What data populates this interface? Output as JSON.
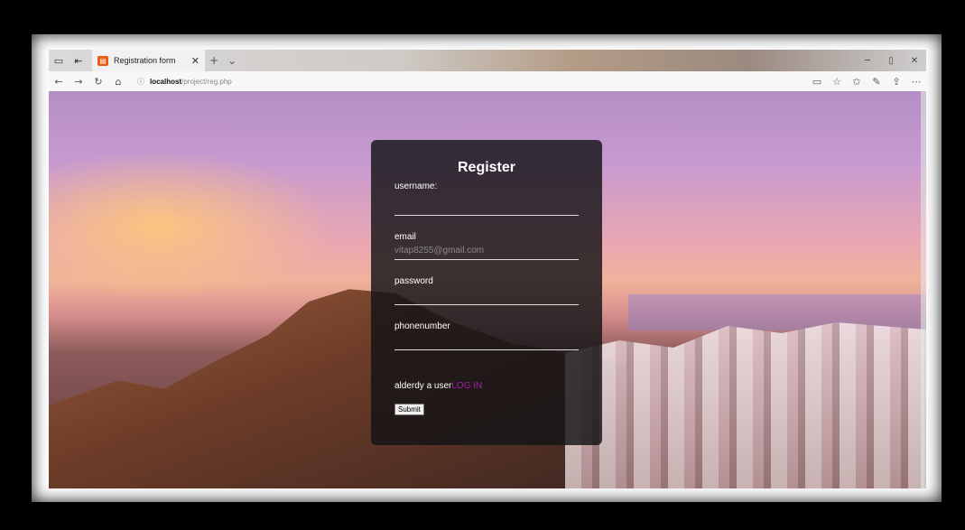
{
  "browser": {
    "tab": {
      "title": "Registration form",
      "favicon": "page-icon"
    },
    "address": {
      "host": "localhost",
      "path": "/project/reg.php"
    },
    "icons": {
      "tab_left_1": "tab-actions-icon",
      "tab_left_2": "set-aside-tabs-icon",
      "new_tab": "plus-icon",
      "tab_menu": "chevron-down-icon",
      "back": "back-arrow-icon",
      "forward": "forward-arrow-icon",
      "refresh": "refresh-icon",
      "home": "home-icon",
      "info": "info-icon",
      "reading_view": "reading-view-icon",
      "favorite": "star-icon",
      "favorites_hub": "favorites-icon",
      "notes": "pen-icon",
      "share": "share-icon",
      "more": "more-icon",
      "minimize": "minimize-icon",
      "maximize": "maximize-icon",
      "close": "close-icon"
    }
  },
  "form": {
    "title": "Register",
    "username_label": "username:",
    "username_value": "",
    "email_label": "email",
    "email_placeholder": "vitap8255@gmail.com",
    "password_label": "password",
    "password_value": "",
    "phone_label": "phonenumber",
    "phone_value": "",
    "login_prefix": "alderdy a user",
    "login_link": "LOG IN",
    "submit_label": "Submit"
  },
  "colors": {
    "login_link": "#a21caf",
    "form_bg": "rgba(20,20,22,.82)"
  }
}
